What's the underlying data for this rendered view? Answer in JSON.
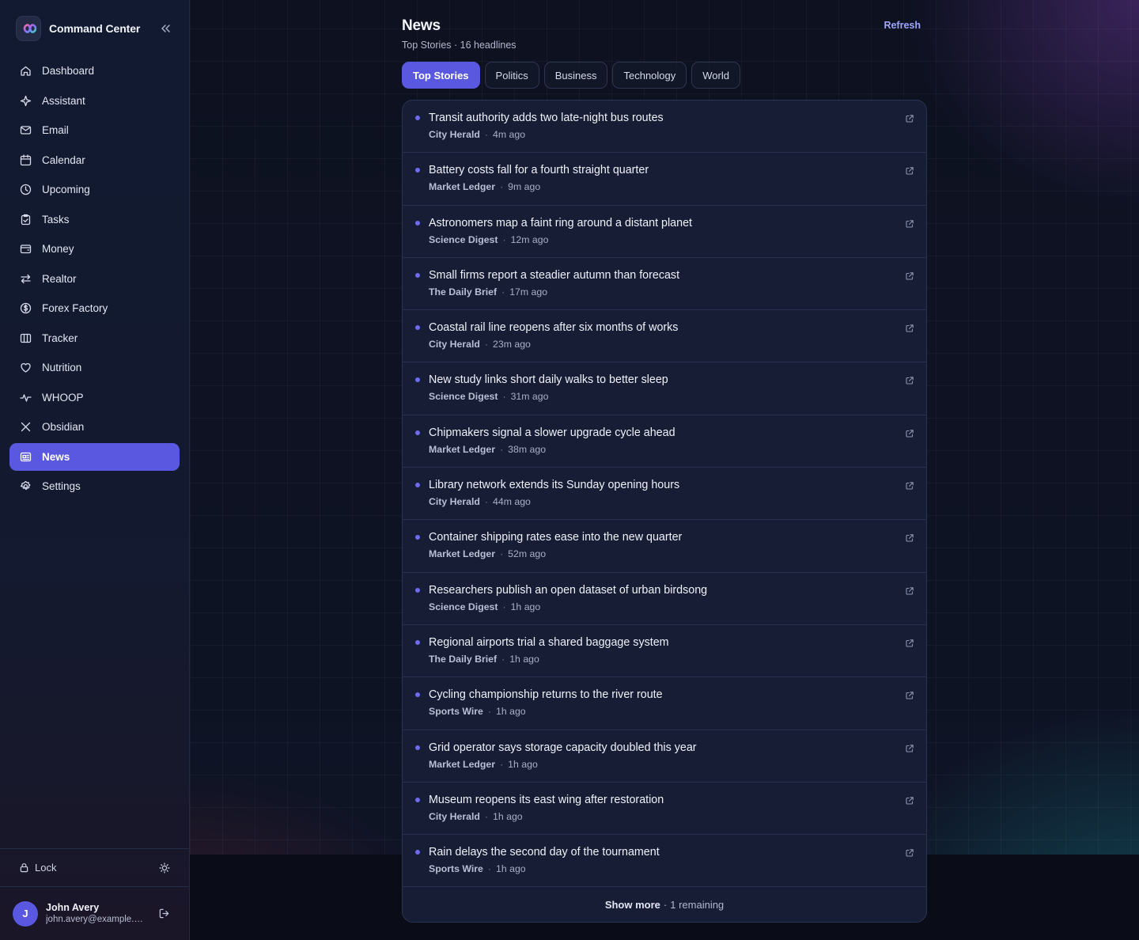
{
  "brand": {
    "title": "Command Center"
  },
  "sidebar": {
    "items": [
      {
        "label": "Dashboard",
        "icon": "home-icon"
      },
      {
        "label": "Assistant",
        "icon": "sparkle-icon"
      },
      {
        "label": "Email",
        "icon": "mail-icon"
      },
      {
        "label": "Calendar",
        "icon": "calendar-icon"
      },
      {
        "label": "Upcoming",
        "icon": "clock-icon"
      },
      {
        "label": "Tasks",
        "icon": "clipboard-icon"
      },
      {
        "label": "Money",
        "icon": "wallet-icon"
      },
      {
        "label": "Realtor",
        "icon": "arrows-swap-icon"
      },
      {
        "label": "Forex Factory",
        "icon": "dollar-circle-icon"
      },
      {
        "label": "Tracker",
        "icon": "columns-icon"
      },
      {
        "label": "Nutrition",
        "icon": "heart-icon"
      },
      {
        "label": "WHOOP",
        "icon": "pulse-icon"
      },
      {
        "label": "Obsidian",
        "icon": "x-cross-icon"
      },
      {
        "label": "News",
        "icon": "newspaper-icon",
        "active": true
      },
      {
        "label": "Settings",
        "icon": "gear-icon"
      }
    ],
    "lock_label": "Lock",
    "user": {
      "initial": "J",
      "name": "John Avery",
      "email": "john.avery@example.com"
    }
  },
  "header": {
    "title": "News",
    "subtitle": "Top Stories · 16 headlines",
    "refresh_label": "Refresh"
  },
  "tabs": [
    {
      "label": "Top Stories",
      "active": true
    },
    {
      "label": "Politics"
    },
    {
      "label": "Business"
    },
    {
      "label": "Technology"
    },
    {
      "label": "World"
    }
  ],
  "news": [
    {
      "headline": "Transit authority adds two late-night bus routes",
      "source": "City Herald",
      "time": "4m ago"
    },
    {
      "headline": "Battery costs fall for a fourth straight quarter",
      "source": "Market Ledger",
      "time": "9m ago"
    },
    {
      "headline": "Astronomers map a faint ring around a distant planet",
      "source": "Science Digest",
      "time": "12m ago"
    },
    {
      "headline": "Small firms report a steadier autumn than forecast",
      "source": "The Daily Brief",
      "time": "17m ago"
    },
    {
      "headline": "Coastal rail line reopens after six months of works",
      "source": "City Herald",
      "time": "23m ago"
    },
    {
      "headline": "New study links short daily walks to better sleep",
      "source": "Science Digest",
      "time": "31m ago"
    },
    {
      "headline": "Chipmakers signal a slower upgrade cycle ahead",
      "source": "Market Ledger",
      "time": "38m ago"
    },
    {
      "headline": "Library network extends its Sunday opening hours",
      "source": "City Herald",
      "time": "44m ago"
    },
    {
      "headline": "Container shipping rates ease into the new quarter",
      "source": "Market Ledger",
      "time": "52m ago"
    },
    {
      "headline": "Researchers publish an open dataset of urban birdsong",
      "source": "Science Digest",
      "time": "1h ago"
    },
    {
      "headline": "Regional airports trial a shared baggage system",
      "source": "The Daily Brief",
      "time": "1h ago"
    },
    {
      "headline": "Cycling championship returns to the river route",
      "source": "Sports Wire",
      "time": "1h ago"
    },
    {
      "headline": "Grid operator says storage capacity doubled this year",
      "source": "Market Ledger",
      "time": "1h ago"
    },
    {
      "headline": "Museum reopens its east wing after restoration",
      "source": "City Herald",
      "time": "1h ago"
    },
    {
      "headline": "Rain delays the second day of the tournament",
      "source": "Sports Wire",
      "time": "1h ago"
    }
  ],
  "show_more": {
    "label": "Show more",
    "remaining": "1 remaining"
  },
  "colors": {
    "accent": "#5a58e0",
    "link": "#9fa6ff",
    "dot": "#6e6cf5"
  }
}
